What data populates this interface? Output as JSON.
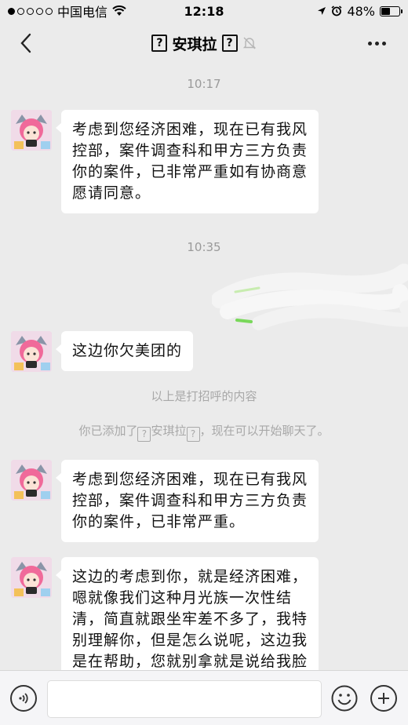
{
  "status_bar": {
    "carrier": "中国电信",
    "time": "12:18",
    "battery": "48%",
    "battery_level": 0.48
  },
  "nav": {
    "title": "安琪拉",
    "title_glyph": "?"
  },
  "messages": [
    {
      "timestamp": "10:17"
    },
    {
      "text_lines": [
        "考虑到您经济困难，现在已有我风",
        "控部，案件调查科和甲方三方负责",
        "你的案件，已非常严重如有协商意",
        "愿请同意。"
      ]
    },
    {
      "timestamp": "10:35"
    },
    {
      "text_lines": [
        "这边你欠美团的"
      ]
    },
    {
      "system": "以上是打招呼的内容"
    },
    {
      "system_prefix": "你已添加了",
      "system_name": "安琪拉",
      "system_suffix": "，现在可以开始聊天了。"
    },
    {
      "text_lines": [
        "考虑到您经济困难，现在已有我风",
        "控部，案件调查科和甲方三方负责",
        "你的案件，已非常严重。"
      ]
    },
    {
      "text_lines": [
        "这边的考虑到你，就是经济困难，",
        "嗯就像我们这种月光族一次性结",
        "清，简直就跟坐牢差不多了，我特",
        "别理解你，但是怎么说呢，这边我",
        "是在帮助，您就别拿就是说给我脸"
      ]
    }
  ],
  "input": {
    "placeholder": ""
  },
  "icons": {
    "back": "chevron-left-icon",
    "more": "more-icon",
    "mute": "bell-mute-icon",
    "wifi": "wifi-icon",
    "location": "location-arrow-icon",
    "alarm": "alarm-icon",
    "voice": "voice-icon",
    "emoji": "emoji-icon",
    "plus": "plus-icon"
  }
}
